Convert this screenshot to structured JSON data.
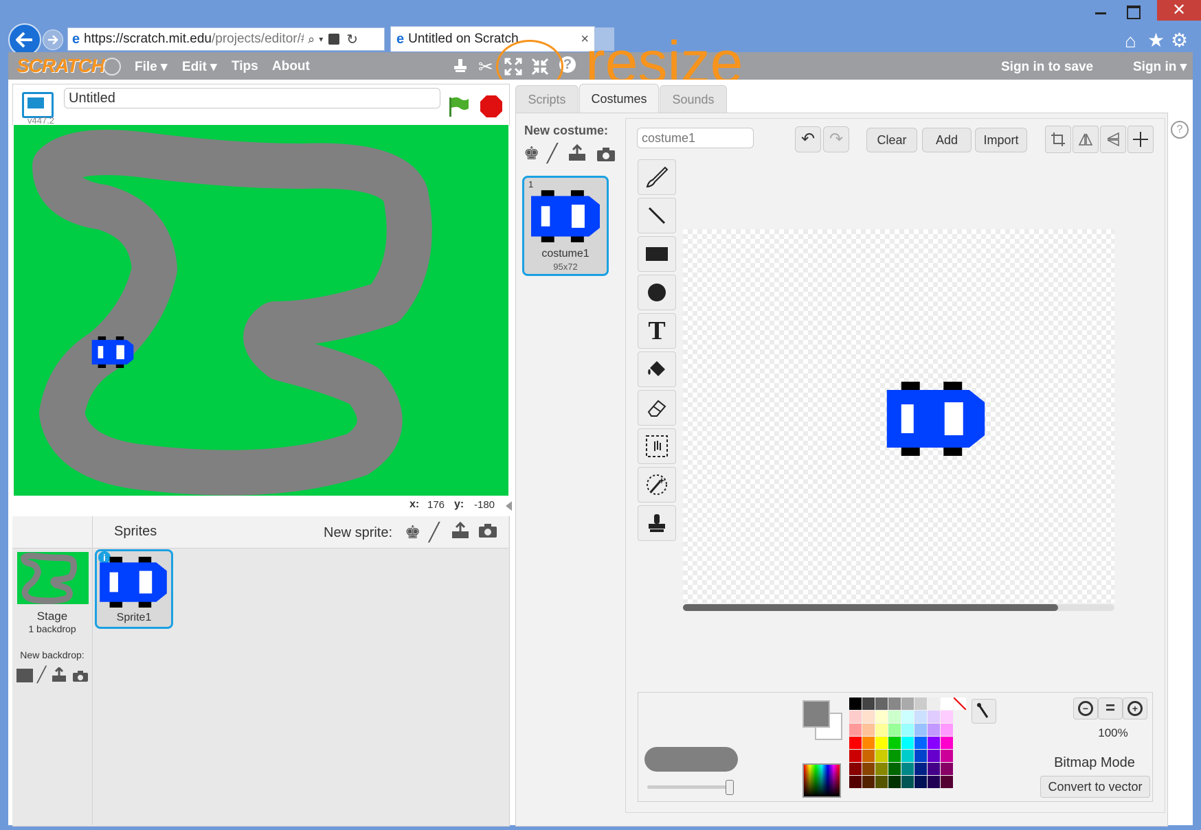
{
  "browser": {
    "url_host": "https://scratch.mit.edu",
    "url_path": "/projects/editor/#e",
    "tab_title": "Untitled on Scratch",
    "tab_close": "×"
  },
  "menubar": {
    "logo": "SCRATCH",
    "file": "File ▾",
    "edit": "Edit ▾",
    "tips": "Tips",
    "about": "About",
    "help_glyph": "?",
    "sign_in_to_save": "Sign in to save",
    "sign_in": "Sign in ▾"
  },
  "annotation": {
    "text": "resize",
    "color": "#f7941d"
  },
  "stage": {
    "project_title": "Untitled",
    "version": "v447.2",
    "x_label": "x:",
    "x_value": "176",
    "y_label": "y:",
    "y_value": "-180"
  },
  "sprites_pane": {
    "title": "Sprites",
    "new_sprite_label": "New sprite:",
    "stage_label": "Stage",
    "backdrop_count": "1 backdrop",
    "new_backdrop_label": "New backdrop:",
    "sprite_name": "Sprite1",
    "info_glyph": "i"
  },
  "tabs": [
    {
      "label": "Scripts"
    },
    {
      "label": "Costumes"
    },
    {
      "label": "Sounds"
    }
  ],
  "costumes": {
    "new_costume_label": "New costume:",
    "costume_index": "1",
    "costume_name": "costume1",
    "costume_size": "95x72"
  },
  "editor": {
    "name_placeholder": "costume1",
    "clear": "Clear",
    "add": "Add",
    "import": "Import",
    "zoom_level": "100%",
    "mode": "Bitmap Mode",
    "convert": "Convert to vector",
    "help_glyph": "?",
    "text_tool_glyph": "T",
    "zoom_out_glyph": "−",
    "zoom_reset_glyph": "=",
    "zoom_in_glyph": "+"
  },
  "colors": {
    "stage_green": "#00cc44",
    "track_gray": "#808080",
    "car_blue": "#0040ff",
    "menubar_gray": "#9c9ea2",
    "selection_blue": "#1ba1e2",
    "palette": [
      [
        "#000000",
        "#444444",
        "#666666",
        "#888888",
        "#aaaaaa",
        "#cccccc",
        "#eeeeee",
        "#ffffff",
        "none"
      ],
      [
        "#ffcccc",
        "#ffe0cc",
        "#ffffcc",
        "#ccffcc",
        "#ccffff",
        "#cce0ff",
        "#e0ccff",
        "#ffccff"
      ],
      [
        "#ff9999",
        "#ffc299",
        "#ffff99",
        "#99ff99",
        "#99ffff",
        "#99c2ff",
        "#c299ff",
        "#ff99ff"
      ],
      [
        "#ff0000",
        "#ff8800",
        "#ffff00",
        "#00cc00",
        "#00ffff",
        "#0066ff",
        "#8800ff",
        "#ff00cc"
      ],
      [
        "#cc0000",
        "#cc6600",
        "#cccc00",
        "#009900",
        "#00cccc",
        "#0044cc",
        "#6600cc",
        "#cc0099"
      ],
      [
        "#880000",
        "#884400",
        "#888800",
        "#006600",
        "#008888",
        "#002288",
        "#440088",
        "#880066"
      ],
      [
        "#550000",
        "#552200",
        "#555500",
        "#003300",
        "#005555",
        "#001155",
        "#220055",
        "#550033"
      ]
    ]
  }
}
